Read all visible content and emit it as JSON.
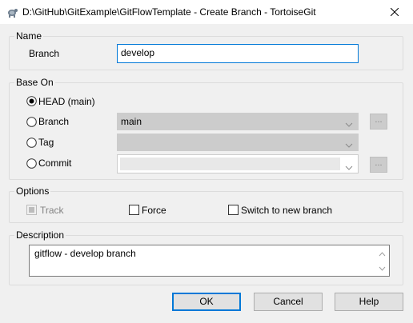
{
  "window": {
    "title": "D:\\GitHub\\GitExample\\GitFlowTemplate - Create Branch - TortoiseGit",
    "app_icon": "tortoisegit-icon",
    "close_icon": "close-icon"
  },
  "name_group": {
    "title": "Name",
    "branch_label": "Branch",
    "branch_value": "develop"
  },
  "base_on_group": {
    "title": "Base On",
    "selected": "HEAD (main)",
    "options": {
      "head": "HEAD (main)",
      "branch": "Branch",
      "tag": "Tag",
      "commit": "Commit"
    },
    "branch_combo_value": "main",
    "tag_combo_value": "",
    "commit_combo_value": "",
    "browse_label": "..."
  },
  "options_group": {
    "title": "Options",
    "track_label": "Track",
    "track_checked": true,
    "track_enabled": false,
    "force_label": "Force",
    "force_checked": false,
    "switch_label": "Switch to new branch",
    "switch_checked": false
  },
  "description_group": {
    "title": "Description",
    "text": "gitflow - develop branch"
  },
  "buttons": {
    "ok": "OK",
    "cancel": "Cancel",
    "help": "Help"
  },
  "colors": {
    "focus_border": "#0078d7",
    "disabled_fill": "#cccccc",
    "dialog_bg": "#f0f0f0"
  }
}
